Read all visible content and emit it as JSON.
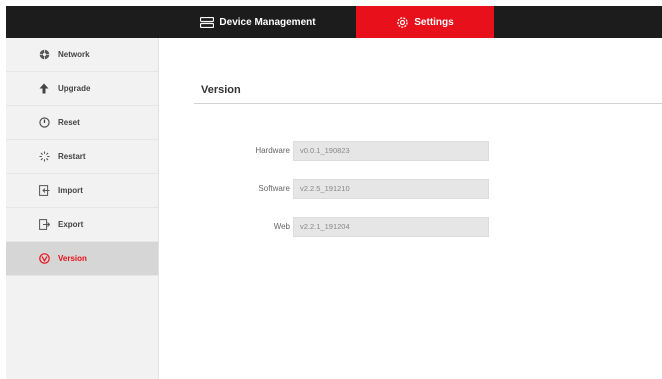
{
  "topbar": {
    "tabs": [
      {
        "label": "Device Management",
        "icon": "device-management-icon"
      },
      {
        "label": "Settings",
        "icon": "gear-icon",
        "active": true
      }
    ]
  },
  "sidebar": {
    "items": [
      {
        "label": "Network",
        "icon": "network-icon"
      },
      {
        "label": "Upgrade",
        "icon": "upload-arrow-icon"
      },
      {
        "label": "Reset",
        "icon": "power-icon"
      },
      {
        "label": "Restart",
        "icon": "spinner-icon"
      },
      {
        "label": "Import",
        "icon": "import-icon"
      },
      {
        "label": "Export",
        "icon": "export-icon"
      },
      {
        "label": "Version",
        "icon": "version-icon",
        "active": true
      }
    ]
  },
  "main": {
    "title": "Version",
    "fields": [
      {
        "label": "Hardware",
        "value": "v0.0.1_190823"
      },
      {
        "label": "Software",
        "value": "v2.2.5_191210"
      },
      {
        "label": "Web",
        "value": "v2.2.1_191204"
      }
    ]
  },
  "colors": {
    "accent": "#e8101a",
    "topbar": "#1c1c1c",
    "sidebar": "#f2f2f2",
    "sidebar_active": "#d6d6d6"
  }
}
